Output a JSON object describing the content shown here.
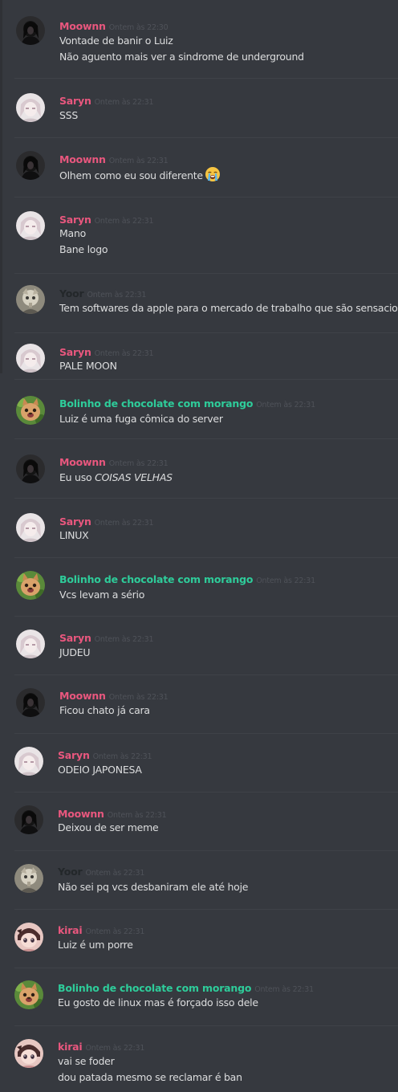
{
  "colors": {
    "background": "#36393f",
    "text": "#dcddde",
    "timestamp": "#4f5259",
    "pink_name": "#e9577e",
    "green_name": "#2ecc9a",
    "dark_name": "#23272a"
  },
  "users": {
    "moownn": {
      "name": "Moownn",
      "color": "#e9577e"
    },
    "saryn": {
      "name": "Saryn",
      "color": "#e9577e"
    },
    "yoor": {
      "name": "Yoor",
      "color": "#23272a"
    },
    "bolinho": {
      "name": "Bolinho de chocolate com morango",
      "color": "#2ecc9a"
    },
    "kirai": {
      "name": "kirai",
      "color": "#e9577e"
    }
  },
  "messages": [
    {
      "author": "Moownn",
      "timestamp": "Ontem às 22:30",
      "lines": [
        "Vontade de banir o Luiz",
        "Não aguento mais ver a sindrome de underground"
      ]
    },
    {
      "author": "Saryn",
      "timestamp": "Ontem às 22:31",
      "lines": [
        "SSS"
      ]
    },
    {
      "author": "Moownn",
      "timestamp": "Ontem às 22:31",
      "lines": [
        "Olhem como eu sou diferente"
      ],
      "emoji": "loudly-crying-face-emoji"
    },
    {
      "author": "Saryn",
      "timestamp": "Ontem às 22:31",
      "lines": [
        "Mano",
        "Bane logo"
      ]
    },
    {
      "author": "Yoor",
      "timestamp": "Ontem às 22:31",
      "lines": [
        "Tem softwares da apple para o mercado de trabalho que são sensacionais"
      ]
    },
    {
      "author": "Saryn",
      "timestamp": "Ontem às 22:31",
      "lines": [
        "PALE MOON"
      ]
    },
    {
      "author": "Bolinho de chocolate com morango",
      "timestamp": "Ontem às 22:31",
      "lines": [
        "Luiz é uma fuga cômica do server"
      ]
    },
    {
      "author": "Moownn",
      "timestamp": "Ontem às 22:31",
      "lines": [
        "Eu uso "
      ],
      "italic": "COISAS VELHAS"
    },
    {
      "author": "Saryn",
      "timestamp": "Ontem às 22:31",
      "lines": [
        "LINUX"
      ]
    },
    {
      "author": "Bolinho de chocolate com morango",
      "timestamp": "Ontem às 22:31",
      "lines": [
        "Vcs levam a sério"
      ]
    },
    {
      "author": "Saryn",
      "timestamp": "Ontem às 22:31",
      "lines": [
        "JUDEU"
      ]
    },
    {
      "author": "Moownn",
      "timestamp": "Ontem às 22:31",
      "lines": [
        "Ficou chato já cara"
      ]
    },
    {
      "author": "Saryn",
      "timestamp": "Ontem às 22:31",
      "lines": [
        "ODEIO JAPONESA"
      ]
    },
    {
      "author": "Moownn",
      "timestamp": "Ontem às 22:31",
      "lines": [
        "Deixou de ser meme"
      ]
    },
    {
      "author": "Yoor",
      "timestamp": "Ontem às 22:31",
      "lines": [
        "Não sei pq vcs desbaniram ele até hoje"
      ]
    },
    {
      "author": "kirai",
      "timestamp": "Ontem às 22:31",
      "lines": [
        "Luiz é um porre"
      ]
    },
    {
      "author": "Bolinho de chocolate com morango",
      "timestamp": "Ontem às 22:31",
      "lines": [
        "Eu gosto de linux mas é forçado isso dele"
      ]
    },
    {
      "author": "kirai",
      "timestamp": "Ontem às 22:31",
      "lines": [
        "vai se foder",
        "dou patada mesmo se reclamar é ban"
      ]
    }
  ]
}
